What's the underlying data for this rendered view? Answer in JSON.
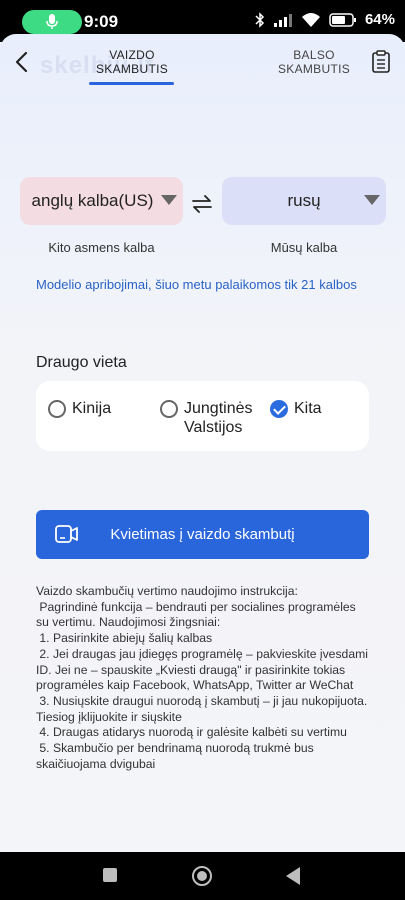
{
  "status_bar": {
    "time": "9:09",
    "battery": "64%"
  },
  "header": {
    "watermark": "skelbiu.lt",
    "tab_video": "VAIZDO\nSKAMBUTIS",
    "tab_voice": "BALSO\nSKAMBUTIS"
  },
  "languages": {
    "other_language": "anglų kalba(US)",
    "our_language": "rusų",
    "other_caption": "Kito asmens kalba",
    "our_caption": "Mūsų kalba"
  },
  "limit_note": "Modelio apribojimai, šiuo metu palaikomos tik 21 kalbos",
  "friend_location": {
    "title": "Draugo vieta",
    "options": [
      {
        "label": "Kinija",
        "checked": false
      },
      {
        "label": "Jungtinės\nValstijos",
        "checked": false
      },
      {
        "label": "Kita",
        "checked": true
      }
    ]
  },
  "invite_button": "Kvietimas į vaizdo skambutį",
  "instructions": [
    "Vaizdo skambučių vertimo naudojimo instrukcija:",
    " Pagrindinė funkcija – bendrauti per socialines programėles su vertimu. Naudojimosi žingsniai:",
    " 1. Pasirinkite abiejų šalių kalbas",
    " 2. Jei draugas jau įdiegęs programėlę – pakvieskite įvesdami ID. Jei ne – spauskite „Kviesti draugą\" ir pasirinkite tokias programėles kaip Facebook, WhatsApp, Twitter ar WeChat",
    " 3. Nusiųskite draugui nuorodą į skambutį – ji jau nukopijuota. Tiesiog įklijuokite ir siųskite",
    " 4. Draugas atidarys nuorodą ir galėsite kalbėti su vertimu",
    " 5. Skambučio per bendrinamą nuorodą trukmė bus skaičiuojama dvigubai"
  ],
  "icons": {
    "accent": "#2a66db"
  }
}
